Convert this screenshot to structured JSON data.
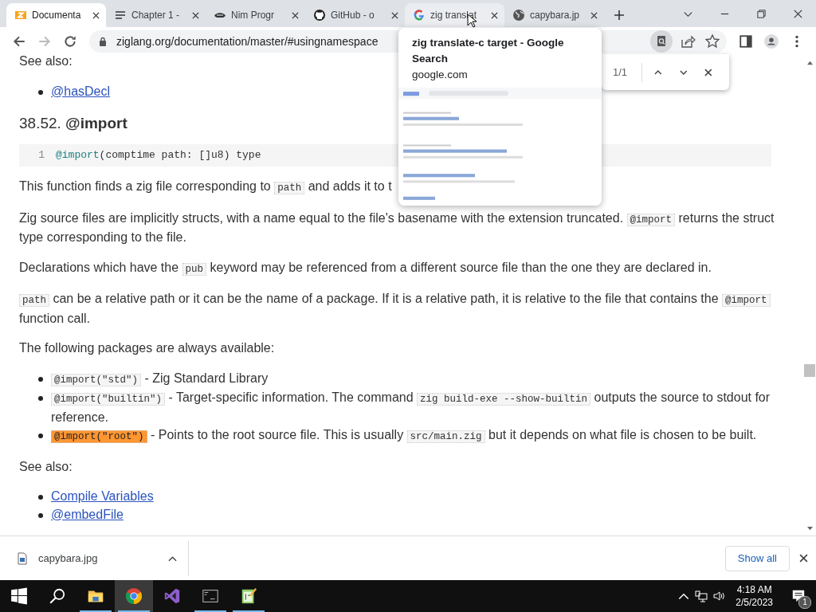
{
  "tabs": [
    {
      "title": "Documenta",
      "selected": true,
      "hovered": false
    },
    {
      "title": "Chapter 1 -",
      "selected": false,
      "hovered": false
    },
    {
      "title": "Nim Progr",
      "selected": false,
      "hovered": false
    },
    {
      "title": "GitHub - o",
      "selected": false,
      "hovered": false
    },
    {
      "title": "zig translat",
      "selected": false,
      "hovered": true
    },
    {
      "title": "capybara.jp",
      "selected": false,
      "hovered": false
    }
  ],
  "address_bar": {
    "url": "ziglang.org/documentation/master/#usingnamespace"
  },
  "hover_card": {
    "title": "zig translate-c target - Google Search",
    "domain": "google.com"
  },
  "find_bar": {
    "count": "1/1"
  },
  "content": {
    "blocks": [
      {
        "kind": "para",
        "segments": [
          {
            "kind": "text",
            "text": "See also:"
          }
        ]
      },
      {
        "kind": "links",
        "items": [
          "@hasDecl"
        ]
      },
      {
        "kind": "heading",
        "text": "38.52. **@import**"
      },
      {
        "kind": "code",
        "lines": [
          {
            "number": "1",
            "tokens": [
              {
                "kind": "builtin",
                "text": "@import"
              },
              {
                "kind": "plain",
                "text": "(comptime path: []u8) type"
              }
            ]
          }
        ]
      },
      {
        "kind": "para",
        "segments": [
          {
            "kind": "text",
            "text": "This function finds a zig file corresponding to "
          },
          {
            "kind": "code",
            "text": "path"
          },
          {
            "kind": "text",
            "text": " and adds it to t"
          }
        ]
      },
      {
        "kind": "para",
        "segments": [
          {
            "kind": "text",
            "text": "Zig source files are implicitly structs, with a name equal to the file's basename with the extension truncated. "
          },
          {
            "kind": "code",
            "text": "@import"
          },
          {
            "kind": "text",
            "text": " returns the struct type corresponding to the file."
          }
        ]
      },
      {
        "kind": "para",
        "segments": [
          {
            "kind": "text",
            "text": "Declarations which have the "
          },
          {
            "kind": "code",
            "text": "pub"
          },
          {
            "kind": "text",
            "text": " keyword may be referenced from a different source file than the one they are declared in."
          }
        ]
      },
      {
        "kind": "para",
        "segments": [
          {
            "kind": "code",
            "text": "path"
          },
          {
            "kind": "text",
            "text": " can be a relative path or it can be the name of a package. If it is a relative path, it is relative to the file that contains the "
          },
          {
            "kind": "code",
            "text": "@import"
          },
          {
            "kind": "text",
            "text": " function call."
          }
        ]
      },
      {
        "kind": "para",
        "segments": [
          {
            "kind": "text",
            "text": "The following packages are always available:"
          }
        ]
      },
      {
        "kind": "bullets",
        "items": [
          {
            "segments": [
              {
                "kind": "code",
                "text": "@import(\"std\")"
              },
              {
                "kind": "text",
                "text": " - Zig Standard Library"
              }
            ]
          },
          {
            "segments": [
              {
                "kind": "code",
                "text": "@import(\"builtin\")"
              },
              {
                "kind": "text",
                "text": " - Target-specific information. The command "
              },
              {
                "kind": "code",
                "text": "zig build-exe --show-builtin"
              },
              {
                "kind": "text",
                "text": " outputs the source to stdout for reference."
              }
            ]
          },
          {
            "segments": [
              {
                "kind": "match",
                "text": "@import(\"root\")"
              },
              {
                "kind": "text",
                "text": " - Points to the root source file. This is usually "
              },
              {
                "kind": "code",
                "text": "src/main.zig"
              },
              {
                "kind": "text",
                "text": " but it depends on what file is chosen to be built."
              }
            ]
          }
        ]
      },
      {
        "kind": "para",
        "segments": [
          {
            "kind": "text",
            "text": "See also:"
          }
        ]
      },
      {
        "kind": "links",
        "items": [
          "Compile Variables",
          "@embedFile"
        ]
      }
    ]
  },
  "downloads": {
    "file": "capybara.jpg",
    "button": "Show all"
  },
  "taskbar": {
    "apps": [
      {
        "kind": "explorer",
        "running": true,
        "active": false
      },
      {
        "kind": "chrome",
        "running": true,
        "active": true
      },
      {
        "kind": "vs",
        "running": false,
        "active": false
      },
      {
        "kind": "terminal",
        "running": true,
        "active": false
      },
      {
        "kind": "notepad",
        "running": true,
        "active": false
      }
    ],
    "time": "4:18 AM",
    "date": "2/5/2023",
    "notifications": "1"
  }
}
